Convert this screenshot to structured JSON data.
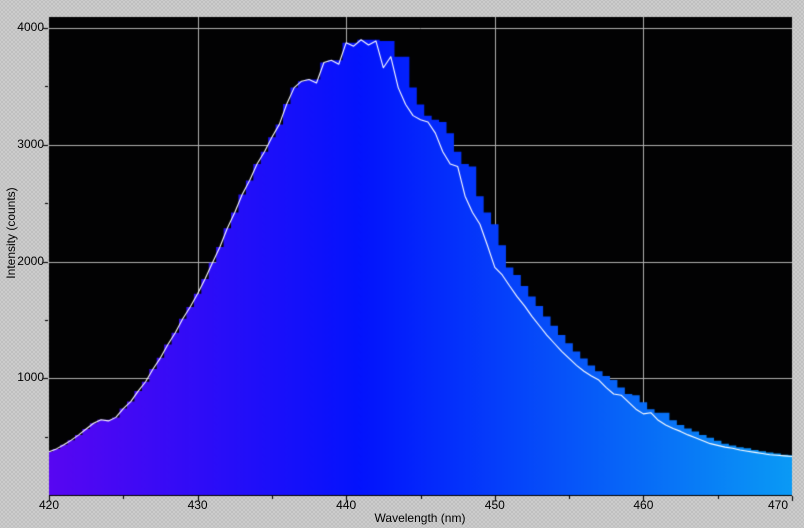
{
  "window": {
    "background_base_color": "#cccccc",
    "background_dot_color": "#9a9a9a"
  },
  "plot": {
    "bg_color": "#020203",
    "grid_color": "#b0b0b0",
    "axis_color": "#000000",
    "xlabel": "Wavelength (nm)",
    "ylabel": "Intensity (counts)",
    "x_tick_labels": [
      "420",
      "430",
      "440",
      "450",
      "460",
      "470"
    ],
    "y_tick_labels": [
      "1000",
      "2000",
      "3000",
      "4000"
    ]
  },
  "chart_data": {
    "type": "area",
    "title": "",
    "xlabel": "Wavelength (nm)",
    "ylabel": "Intensity (counts)",
    "xlim": [
      420,
      470
    ],
    "ylim": [
      0,
      4095
    ],
    "grid": true,
    "x_major_ticks": [
      420,
      430,
      440,
      450,
      460,
      470
    ],
    "x_minor_ticks": [
      425,
      435,
      445,
      455,
      465
    ],
    "y_major_ticks": [
      1000,
      2000,
      3000,
      4000
    ],
    "y_minor_ticks": [
      500,
      1500,
      2500,
      3500
    ],
    "x_start": 420,
    "x_step": 0.5,
    "peak_wavelength_nm": 441,
    "peak_counts": 3900,
    "series": [
      {
        "name": "spectrum-fill",
        "type": "stepped-area",
        "bin_width_nm": 0.5,
        "gradient_stops": [
          {
            "pos": 0.0,
            "color": "#5806F2"
          },
          {
            "pos": 0.42,
            "color": "#0313FD"
          },
          {
            "pos": 1.0,
            "color": "#0A9AF5"
          }
        ],
        "values": [
          370,
          395,
          430,
          470,
          515,
          565,
          615,
          645,
          645,
          665,
          740,
          800,
          890,
          970,
          1080,
          1175,
          1290,
          1390,
          1510,
          1610,
          1725,
          1850,
          1990,
          2125,
          2285,
          2420,
          2575,
          2695,
          2835,
          2940,
          3065,
          3175,
          3350,
          3490,
          3545,
          3560,
          3560,
          3705,
          3725,
          3725,
          3875,
          3875,
          3900,
          3900,
          3900,
          3890,
          3890,
          3755,
          3755,
          3490,
          3345,
          3250,
          3215,
          3195,
          3100,
          2940,
          2835,
          2815,
          2560,
          2420,
          2320,
          2140,
          1950,
          1885,
          1790,
          1700,
          1620,
          1530,
          1450,
          1370,
          1300,
          1230,
          1170,
          1110,
          1060,
          1020,
          985,
          920,
          865,
          855,
          795,
          735,
          705,
          705,
          640,
          600,
          570,
          545,
          515,
          490,
          465,
          440,
          425,
          410,
          400,
          385,
          375,
          365,
          355,
          345,
          340
        ]
      },
      {
        "name": "spectrum-trace",
        "type": "line",
        "color": "#FFFFFF",
        "values": [
          370,
          395,
          430,
          470,
          515,
          565,
          615,
          645,
          635,
          665,
          740,
          800,
          890,
          970,
          1080,
          1175,
          1290,
          1390,
          1510,
          1610,
          1725,
          1850,
          1990,
          2125,
          2285,
          2420,
          2575,
          2695,
          2835,
          2940,
          3065,
          3175,
          3350,
          3490,
          3545,
          3560,
          3530,
          3705,
          3725,
          3690,
          3875,
          3845,
          3900,
          3855,
          3890,
          3660,
          3755,
          3490,
          3345,
          3250,
          3215,
          3195,
          3100,
          2940,
          2835,
          2815,
          2560,
          2420,
          2320,
          2140,
          1950,
          1885,
          1790,
          1700,
          1620,
          1530,
          1450,
          1370,
          1300,
          1230,
          1170,
          1110,
          1060,
          1020,
          985,
          920,
          865,
          855,
          795,
          735,
          695,
          705,
          640,
          600,
          570,
          545,
          515,
          490,
          465,
          440,
          425,
          410,
          400,
          385,
          375,
          365,
          355,
          345,
          340,
          335,
          330
        ]
      }
    ]
  }
}
